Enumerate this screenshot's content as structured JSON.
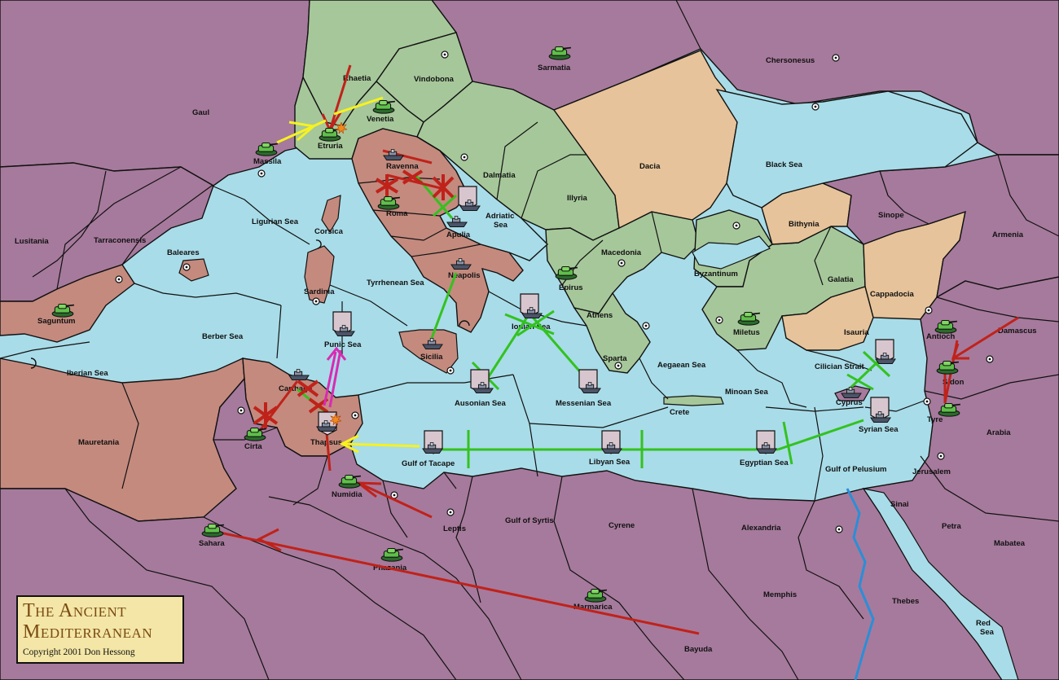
{
  "title": {
    "line1": "The Ancient",
    "line2": "Mediterranean",
    "copyright": "Copyright  2001  Don Hessong"
  },
  "colors": {
    "sea": "#a8dce8",
    "neutral_land": "#a67a9c",
    "green_power": "#a6c79a",
    "red_power": "#c48a7e",
    "tan_power": "#e6c39a",
    "move_red": "#c0221a",
    "move_green": "#33c21e",
    "move_yellow": "#f7f21e",
    "move_magenta": "#d92ab4"
  },
  "provinces": [
    {
      "key": "rhaetia",
      "name": "Rhaetia"
    },
    {
      "key": "vindobona",
      "name": "Vindobona"
    },
    {
      "key": "sarmatia",
      "name": "Sarmatia"
    },
    {
      "key": "chersonesus",
      "name": "Chersonesus"
    },
    {
      "key": "gaul",
      "name": "Gaul"
    },
    {
      "key": "venetia",
      "name": "Venetia"
    },
    {
      "key": "etruria",
      "name": "Etruria"
    },
    {
      "key": "massila",
      "name": "Massila"
    },
    {
      "key": "ravenna",
      "name": "Ravenna"
    },
    {
      "key": "dalmatia",
      "name": "Dalmatia"
    },
    {
      "key": "dacia",
      "name": "Dacia"
    },
    {
      "key": "black_sea",
      "name": "Black Sea"
    },
    {
      "key": "illyria",
      "name": "Illyria"
    },
    {
      "key": "roma",
      "name": "Roma"
    },
    {
      "key": "adriatic_sea",
      "name": "Adriatic Sea"
    },
    {
      "key": "apulia",
      "name": "Apulia"
    },
    {
      "key": "ligurian_sea",
      "name": "Ligurian Sea"
    },
    {
      "key": "corsica",
      "name": "Corsica"
    },
    {
      "key": "bithynia",
      "name": "Bithynia"
    },
    {
      "key": "sinope",
      "name": "Sinope"
    },
    {
      "key": "lusitania",
      "name": "Lusitania"
    },
    {
      "key": "tarraconensis",
      "name": "Tarraconensis"
    },
    {
      "key": "armenia",
      "name": "Armenia"
    },
    {
      "key": "baleares",
      "name": "Baleares"
    },
    {
      "key": "macedonia",
      "name": "Macedonia"
    },
    {
      "key": "byzantinum",
      "name": "Byzantinum"
    },
    {
      "key": "neapolis",
      "name": "Neapolis"
    },
    {
      "key": "galatia",
      "name": "Galatia"
    },
    {
      "key": "epirus",
      "name": "Epirus"
    },
    {
      "key": "tyrrhenean_sea",
      "name": "Tyrrhenean Sea"
    },
    {
      "key": "sardinia",
      "name": "Sardinia"
    },
    {
      "key": "cappadocia",
      "name": "Cappadocia"
    },
    {
      "key": "saguntum",
      "name": "Saguntum"
    },
    {
      "key": "athens",
      "name": "Athens"
    },
    {
      "key": "ionian_sea",
      "name": "Ionian Sea"
    },
    {
      "key": "miletus",
      "name": "Miletus"
    },
    {
      "key": "isauria",
      "name": "Isauria"
    },
    {
      "key": "antioch",
      "name": "Antioch"
    },
    {
      "key": "damascus",
      "name": "Damascus"
    },
    {
      "key": "berber_sea",
      "name": "Berber Sea"
    },
    {
      "key": "punic_sea",
      "name": "Punic Sea"
    },
    {
      "key": "sparta",
      "name": "Sparta"
    },
    {
      "key": "sicilia",
      "name": "Sicilia"
    },
    {
      "key": "aegaean_sea",
      "name": "Aegaean Sea"
    },
    {
      "key": "cilician_strait",
      "name": "Cilician Strait"
    },
    {
      "key": "iberian_sea",
      "name": "Iberian Sea"
    },
    {
      "key": "sidon",
      "name": "Sidon"
    },
    {
      "key": "carthage",
      "name": "Carthage"
    },
    {
      "key": "minoan_sea",
      "name": "Minoan Sea"
    },
    {
      "key": "ausonian_sea",
      "name": "Ausonian Sea"
    },
    {
      "key": "messenian_sea",
      "name": "Messenian Sea"
    },
    {
      "key": "cyprus",
      "name": "Cyprus"
    },
    {
      "key": "crete",
      "name": "Crete"
    },
    {
      "key": "tyre",
      "name": "Tyre"
    },
    {
      "key": "syrian_sea",
      "name": "Syrian Sea"
    },
    {
      "key": "mauretania",
      "name": "Mauretania"
    },
    {
      "key": "thapsus",
      "name": "Thapsus"
    },
    {
      "key": "cirta",
      "name": "Cirta"
    },
    {
      "key": "arabia",
      "name": "Arabia"
    },
    {
      "key": "gulf_of_tacape",
      "name": "Gulf of Tacape"
    },
    {
      "key": "libyan_sea",
      "name": "Libyan Sea"
    },
    {
      "key": "egyptian_sea",
      "name": "Egyptian Sea"
    },
    {
      "key": "gulf_of_pelusium",
      "name": "Gulf of Pelusium"
    },
    {
      "key": "jerusalem",
      "name": "Jerusalem"
    },
    {
      "key": "numidia",
      "name": "Numidia"
    },
    {
      "key": "sinai",
      "name": "Sinai"
    },
    {
      "key": "gulf_of_syrtis",
      "name": "Gulf of Syrtis"
    },
    {
      "key": "leptis",
      "name": "Leptis"
    },
    {
      "key": "cyrene",
      "name": "Cyrene"
    },
    {
      "key": "alexandria",
      "name": "Alexandria"
    },
    {
      "key": "petra",
      "name": "Petra"
    },
    {
      "key": "sahara",
      "name": "Sahara"
    },
    {
      "key": "mabatea",
      "name": "Mabatea"
    },
    {
      "key": "phazania",
      "name": "Phazania"
    },
    {
      "key": "memphis",
      "name": "Memphis"
    },
    {
      "key": "thebes",
      "name": "Thebes"
    },
    {
      "key": "marmarica",
      "name": "Marmarica"
    },
    {
      "key": "red_sea",
      "name": "Red\nSea"
    },
    {
      "key": "bayuda",
      "name": "Bayuda"
    }
  ],
  "unit_icons": {
    "army": "army-tank-icon",
    "fleet": "fleet-ship-icon",
    "supply_center": "supply-center-icon",
    "dislodged": "dislodged-burst-icon",
    "failed_order": "failed-order-x-icon",
    "convoy_arc": "convoy-arc-icon"
  }
}
